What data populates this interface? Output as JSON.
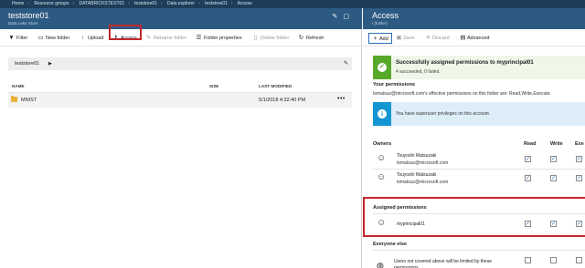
{
  "breadcrumb": [
    "Home",
    "Resource groups",
    "DATABRICKSTEST01",
    "teststore01",
    "Data explorer",
    "teststore01",
    "Access"
  ],
  "left": {
    "title": "teststore01",
    "subtitle": "Data Lake Store",
    "toolbar": {
      "filter": "Filter",
      "new_folder": "New folder",
      "upload": "Upload",
      "access": "Access",
      "rename_folder": "Rename folder",
      "folder_properties": "Folder properties",
      "delete_folder": "Delete folder",
      "refresh": "Refresh"
    },
    "path": "teststore01",
    "columns": {
      "name": "NAME",
      "size": "SIZE",
      "last_modified": "LAST MODIFIED"
    },
    "rows": [
      {
        "name": "MNIST",
        "size": "",
        "last_modified": "5/1/2018 4:32:40 PM"
      }
    ]
  },
  "right": {
    "title": "Access",
    "subtitle": "/ (folder)",
    "toolbar": {
      "add": "Add",
      "save": "Save",
      "discard": "Discard",
      "advanced": "Advanced"
    },
    "notification": {
      "title": "Successfully assigned permissions to myprincipal01",
      "text": "4 succeeded, 0 failed."
    },
    "your_permissions": {
      "heading": "Your permissions",
      "text": "tsmatsuz@microsoft.com's effective permissions on this folder are: Read,Write,Execute."
    },
    "info": {
      "text": "You have superuser privileges on this account."
    },
    "columns": {
      "read": "Read",
      "write": "Write",
      "execute": "Exe"
    },
    "owners": {
      "label": "Owners",
      "rows": [
        {
          "name": "Tsuyoshi Matsuzaki",
          "email": "tsmatsuz@microsoft.com",
          "read": true,
          "write": true,
          "execute": true
        },
        {
          "name": "Tsuyoshi Matsuzaki",
          "email": "tsmatsuz@microsoft.com",
          "read": true,
          "write": true,
          "execute": true
        }
      ]
    },
    "assigned": {
      "label": "Assigned permissions",
      "rows": [
        {
          "name": "myprincipal01",
          "read": true,
          "write": true,
          "execute": true
        }
      ]
    },
    "everyone": {
      "label": "Everyone else",
      "text": "Users not covered above will be limited by these permissions",
      "read": false,
      "write": false,
      "execute": false
    }
  },
  "colors": {
    "header_bg": "#2d5a82",
    "topbar_bg": "#1e3d5a",
    "highlight_red": "#c1272d",
    "success_green": "#58a829",
    "info_blue": "#1496d3",
    "folder_yellow": "#e8b33a"
  },
  "icons": {
    "filter": "filter-icon",
    "new_folder": "folder-add-icon",
    "upload": "upload-icon",
    "access": "key-icon",
    "rename": "pencil-icon",
    "properties": "list-icon",
    "delete": "trash-icon",
    "refresh": "refresh-icon",
    "pin": "pin-icon",
    "maximize": "maximize-icon",
    "close": "close-icon",
    "user": "user-icon",
    "group": "group-icon",
    "globe": "globe-icon",
    "success": "checkmark-icon",
    "info": "info-icon"
  }
}
